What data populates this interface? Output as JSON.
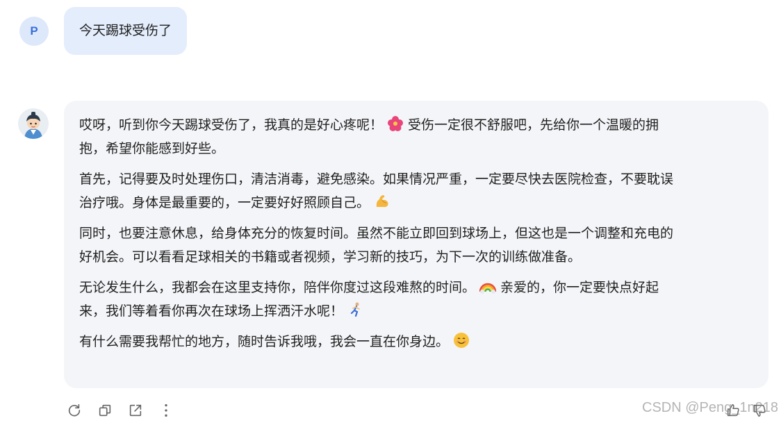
{
  "user": {
    "avatar_letter": "P",
    "message": "今天踢球受伤了"
  },
  "bot": {
    "paragraphs": [
      {
        "lines": [
          {
            "text": "哎呀，听到你今天踢球受伤了，我真的是好心疼呢！",
            "emoji": "hibiscus-emoji",
            "after": "受伤一定很不舒服吧，先给你一个温暖的拥"
          },
          {
            "text": "抱，希望你能感到好些。"
          }
        ]
      },
      {
        "lines": [
          {
            "text": "首先，记得要及时处理伤口，清洁消毒，避免感染。如果情况严重，一定要尽快去医院检查，不要耽误"
          },
          {
            "text": "治疗哦。身体是最重要的，一定要好好照顾自己。",
            "emoji": "flexed-biceps-emoji"
          }
        ]
      },
      {
        "lines": [
          {
            "text": "同时，也要注意休息，给身体充分的恢复时间。虽然不能立即回到球场上，但这也是一个调整和充电的"
          },
          {
            "text": "好机会。可以看看足球相关的书籍或者视频，学习新的技巧，为下一次的训练做准备。"
          }
        ]
      },
      {
        "lines": [
          {
            "text": "无论发生什么，我都会在这里支持你，陪伴你度过这段难熬的时间。",
            "emoji": "rainbow-emoji",
            "after": "亲爱的，你一定要快点好起"
          },
          {
            "text": "来，我们等着看你再次在球场上挥洒汗水呢！",
            "emoji": "runner-emoji"
          }
        ]
      },
      {
        "lines": [
          {
            "text": "有什么需要我帮忙的地方，随时告诉我哦，我会一直在你身边。",
            "emoji": "smiling-face-emoji"
          }
        ]
      }
    ]
  },
  "toolbar": {
    "icons": [
      "refresh-icon",
      "copy-icon",
      "share-icon",
      "more-icon",
      "thumbs-up-icon",
      "thumbs-down-icon"
    ]
  },
  "watermark": {
    "csdn": "CSDN @Peng_1n218"
  },
  "colors": {
    "user_bubble": "#e3edfc",
    "bot_bubble": "#f4f5f8",
    "avatar_letter": "#3a6fd8"
  }
}
